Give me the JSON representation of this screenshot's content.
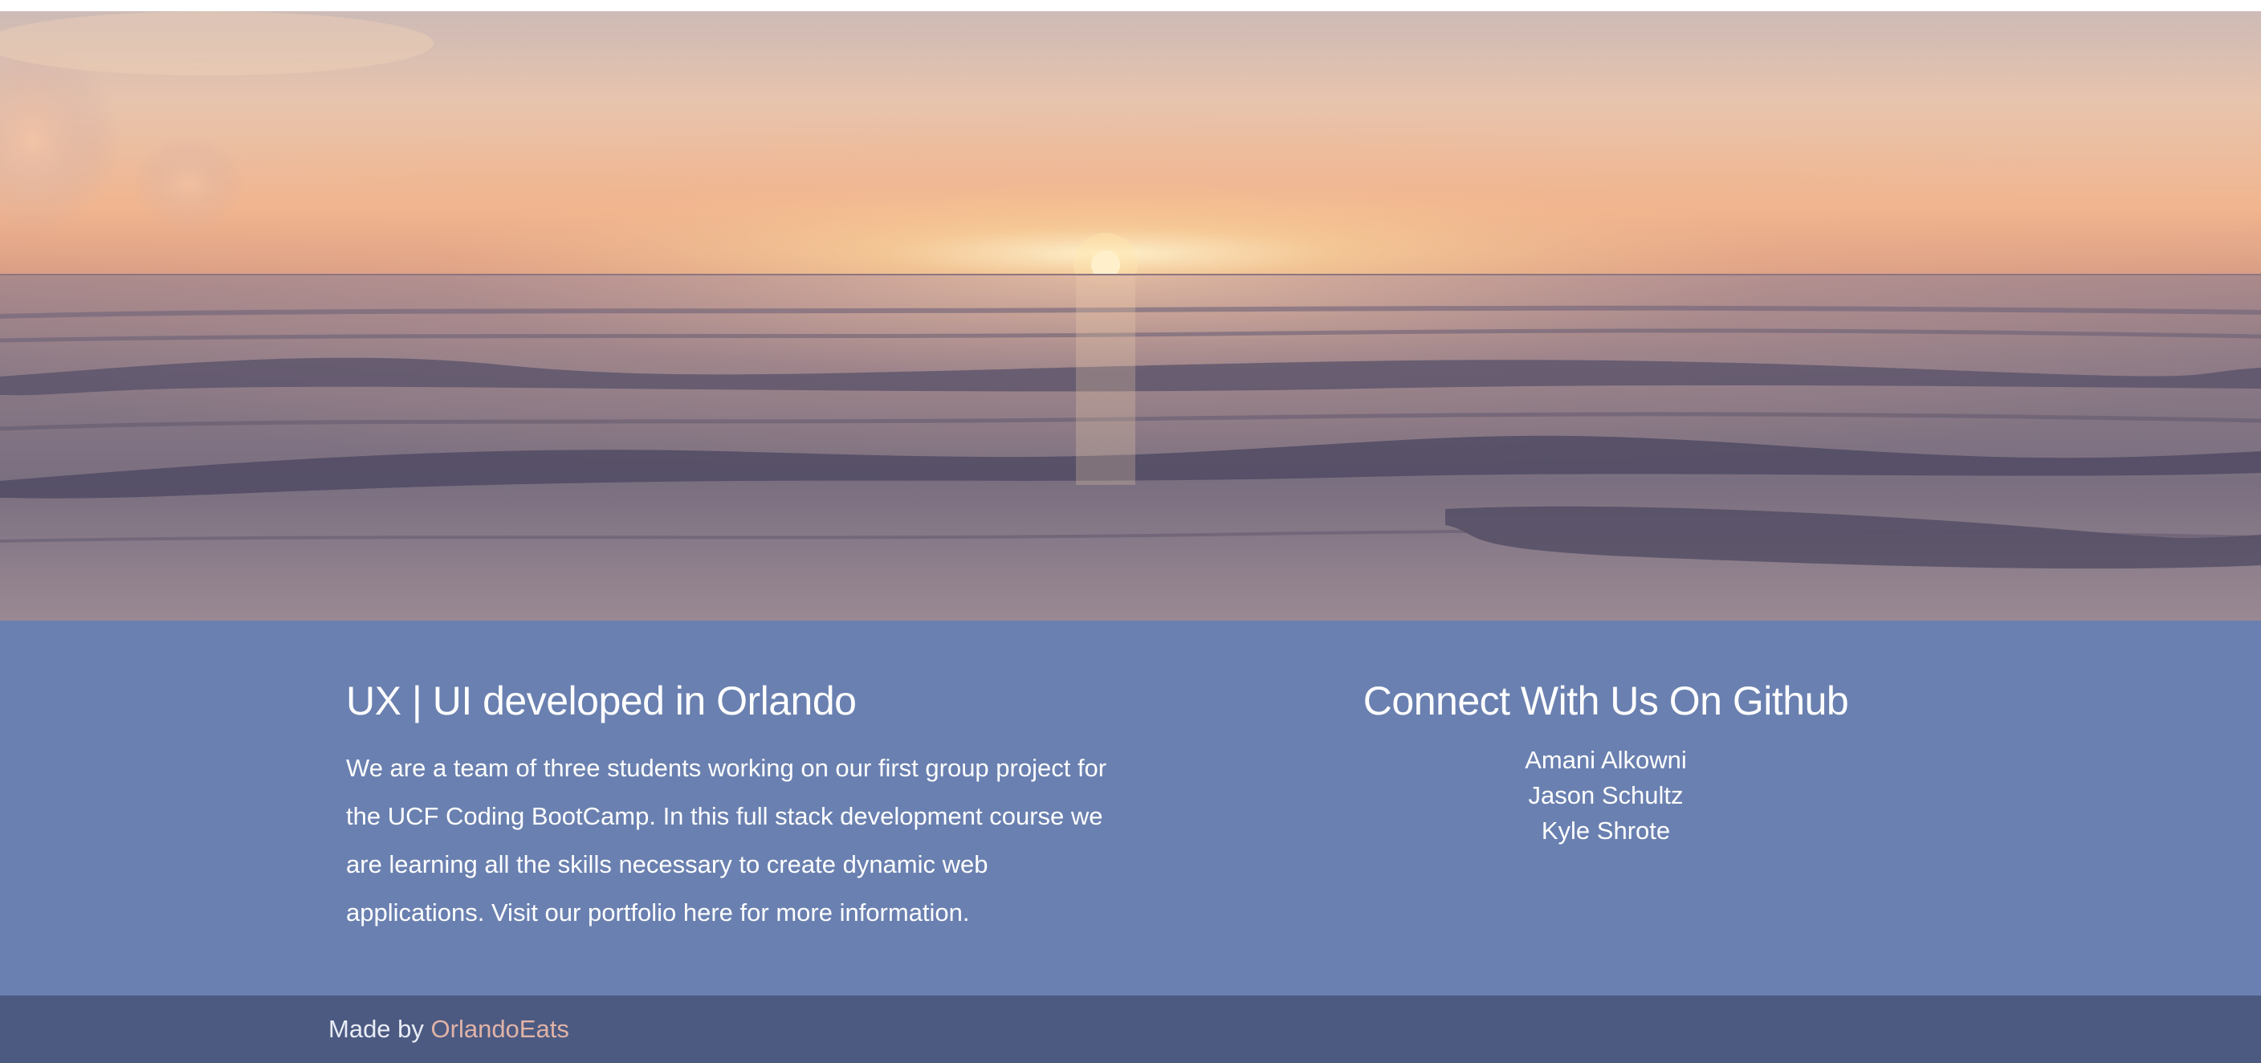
{
  "hero": {
    "alt": "sunset over ocean waves",
    "colors": {
      "sky_top": "#c9b6b4",
      "sky_glow": "#f6c08b",
      "sun": "#fff6d8",
      "sea": "#7e707d",
      "wave_dark": "#4e4a62"
    }
  },
  "about": {
    "heading": "UX | UI developed in Orlando",
    "body": "We are a team of three students working on our first group project for the UCF Coding BootCamp. In this full stack development course we are learning all the skills necessary to create dynamic web applications. Visit our portfolio here for more information."
  },
  "connect": {
    "heading": "Connect With Us On Github",
    "members": [
      "Amani Alkowni",
      "Jason Schultz",
      "Kyle Shrote"
    ]
  },
  "footer": {
    "prefix": "Made by ",
    "brand": "OrlandoEats"
  },
  "colors": {
    "info_bg": "#6a80b0",
    "footer_bg": "#4c5a82",
    "brand_link": "#e1b3a6",
    "text": "#ffffff"
  }
}
